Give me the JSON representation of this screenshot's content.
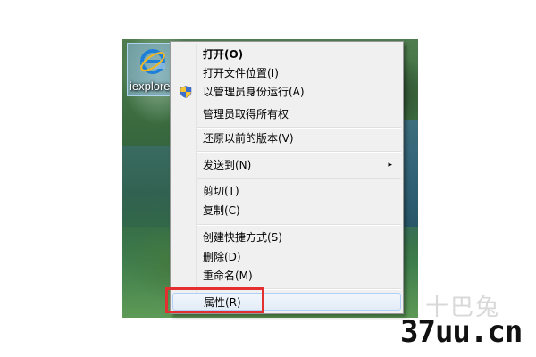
{
  "desktop": {
    "icon_label": "iexplore",
    "icon_name": "internet-explorer-icon"
  },
  "context_menu": {
    "items": [
      {
        "label": "打开(O)",
        "bold": true
      },
      {
        "label": "打开文件位置(I)"
      },
      {
        "label": "以管理员身份运行(A)",
        "icon": "uac-shield-icon"
      },
      {
        "label": "管理员取得所有权"
      },
      {
        "label": "还原以前的版本(V)"
      },
      {
        "label": "发送到(N)",
        "submenu_arrow": "▸"
      },
      {
        "label": "剪切(T)"
      },
      {
        "label": "复制(C)"
      },
      {
        "label": "创建快捷方式(S)"
      },
      {
        "label": "删除(D)"
      },
      {
        "label": "重命名(M)"
      },
      {
        "label": "属性(R)",
        "highlighted": true
      }
    ]
  },
  "annotation": {
    "highlight_color": "#e32f2f"
  },
  "watermark": {
    "glyphs": "十巴兔",
    "site": "37uu.cn"
  }
}
